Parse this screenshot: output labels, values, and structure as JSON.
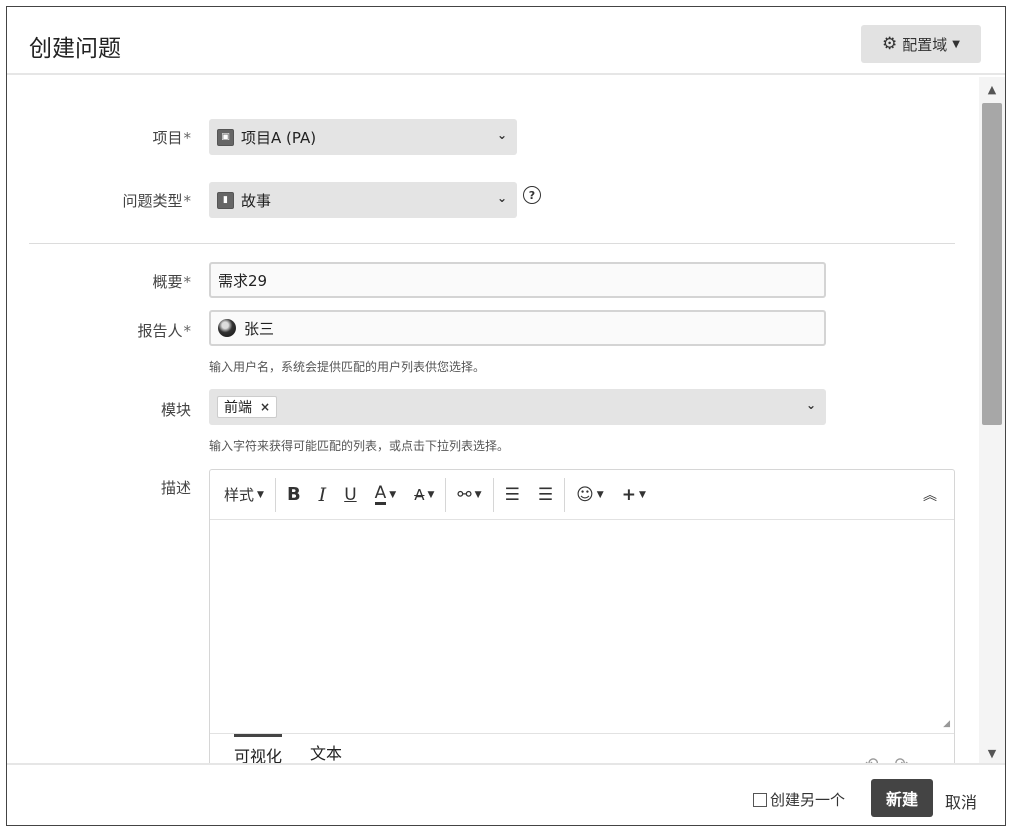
{
  "dialog": {
    "title": "创建问题",
    "config_button": {
      "label": "配置域",
      "icon": "gear-icon"
    }
  },
  "form": {
    "project": {
      "label": "项目",
      "required_mark": "*",
      "value": "项目A (PA)"
    },
    "issue_type": {
      "label": "问题类型",
      "required_mark": "*",
      "value": "故事",
      "help_icon": "question-circle-icon"
    },
    "summary": {
      "label": "概要",
      "required_mark": "*",
      "value": "需求29"
    },
    "reporter": {
      "label": "报告人",
      "required_mark": "*",
      "value": "张三",
      "hint": "输入用户名，系统会提供匹配的用户列表供您选择。"
    },
    "component": {
      "label": "模块",
      "tags": [
        "前端"
      ],
      "hint": "输入字符来获得可能匹配的列表，或点击下拉列表选择。"
    },
    "description": {
      "label": "描述",
      "toolbar": {
        "style_label": "样式",
        "bold": "B",
        "italic": "I",
        "underline": "U",
        "text_color": "A",
        "more_format": "A",
        "link": "⚯",
        "bullet_list": "☰",
        "numbered_list": "☰",
        "emoji": "☺",
        "insert": "+",
        "collapse": "⌃"
      },
      "tabs": [
        "可视化",
        "文本"
      ],
      "active_tab": "可视化"
    }
  },
  "footer": {
    "create_another_label": "创建另一个",
    "create_button": "新建",
    "cancel_button": "取消"
  }
}
